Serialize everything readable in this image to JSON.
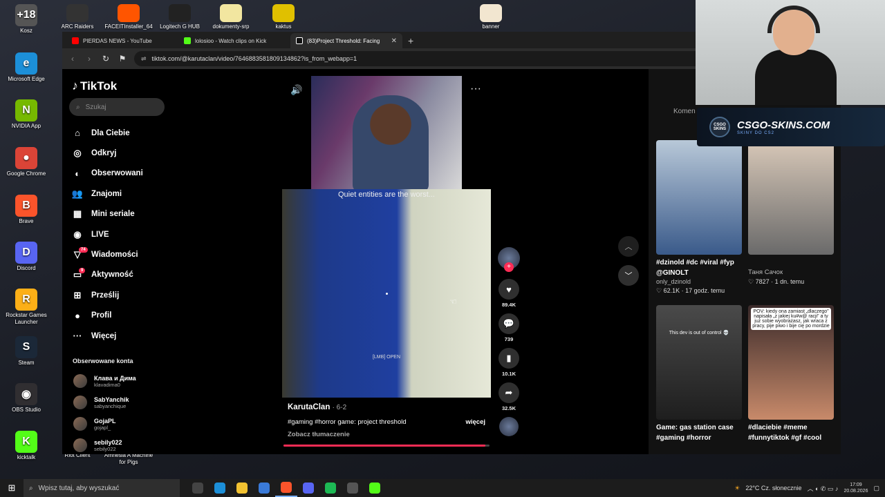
{
  "desktop_icons": [
    {
      "label": "Kosz",
      "glyph": "+18",
      "color": "#555"
    },
    {
      "label": "Microsoft Edge",
      "glyph": "e",
      "color": "#1c8fd8"
    },
    {
      "label": "NVIDIA App",
      "glyph": "N",
      "color": "#76b900"
    },
    {
      "label": "Google Chrome",
      "glyph": "●",
      "color": "#db4437"
    },
    {
      "label": "Brave",
      "glyph": "B",
      "color": "#fb542b"
    },
    {
      "label": "Discord",
      "glyph": "D",
      "color": "#5865f2"
    },
    {
      "label": "Rockstar Games Launcher",
      "glyph": "R",
      "color": "#fcaf17"
    },
    {
      "label": "Steam",
      "glyph": "S",
      "color": "#1b2838"
    },
    {
      "label": "OBS Studio",
      "glyph": "◉",
      "color": "#302e31"
    },
    {
      "label": "kicktalk",
      "glyph": "K",
      "color": "#53fc18"
    }
  ],
  "top_icons": [
    {
      "label": "ARC Raiders",
      "color": "#333"
    },
    {
      "label": "FACEITInstaller_64",
      "color": "#ff5500"
    },
    {
      "label": "Logitech G HUB",
      "color": "#222"
    },
    {
      "label": "dokumenty-srp",
      "color": "#f2e6a0"
    },
    {
      "label": "kaktus",
      "color": "#e0c000"
    },
    {
      "label": "banner",
      "color": "#f2e6d0"
    }
  ],
  "bottom_icons": [
    {
      "label": "Riot Client"
    },
    {
      "label": "Amnesia A Machine for Pigs"
    }
  ],
  "browser": {
    "tabs": [
      {
        "title": "PIERDAS NEWS - YouTube",
        "color": "#ff0000"
      },
      {
        "title": "lolosioo - Watch clips on Kick",
        "color": "#53fc18"
      },
      {
        "title": "(83)Project Threshold: Facing",
        "color": "#fff"
      }
    ],
    "new_tab": "+",
    "url": "tiktok.com/@karutaclan/video/7646883581809134862?is_from_webapp=1"
  },
  "tiktok": {
    "logo": "TikTok",
    "search_placeholder": "Szukaj",
    "nav": [
      {
        "label": "Dla Ciebie",
        "icon": "home-icon",
        "glyph": "⌂"
      },
      {
        "label": "Odkryj",
        "icon": "compass-icon",
        "glyph": "◎"
      },
      {
        "label": "Obserwowani",
        "icon": "following-icon",
        "glyph": "◐"
      },
      {
        "label": "Znajomi",
        "icon": "friends-icon",
        "glyph": "👥"
      },
      {
        "label": "Mini seriale",
        "icon": "film-icon",
        "glyph": "▦"
      },
      {
        "label": "LIVE",
        "icon": "live-icon",
        "glyph": "◉"
      },
      {
        "label": "Wiadomości",
        "icon": "messages-icon",
        "glyph": "▽",
        "badge": "74"
      },
      {
        "label": "Aktywność",
        "icon": "activity-icon",
        "glyph": "▭",
        "badge": "9"
      },
      {
        "label": "Prześlij",
        "icon": "upload-icon",
        "glyph": "⊞"
      },
      {
        "label": "Profil",
        "icon": "profile-icon",
        "glyph": "●"
      },
      {
        "label": "Więcej",
        "icon": "more-icon",
        "glyph": "···"
      }
    ],
    "following_title": "Obserwowane konta",
    "following": [
      {
        "name": "Клава и Дима",
        "handle": "klavadima0"
      },
      {
        "name": "SabYanchik",
        "handle": "sabyanchique"
      },
      {
        "name": "GojaPL",
        "handle": "gojapl_"
      },
      {
        "name": "sebily022",
        "handle": "sebily022"
      }
    ],
    "video": {
      "caption": "Quiet entities are the worst...",
      "open_label": "[LMB] OPEN",
      "author": "KarutaClan",
      "date": "· 6-2",
      "description": "#gaming #horror  game: project threshold",
      "more": "więcej",
      "translate": "Zobacz tłumaczenie",
      "progress": 0.98
    },
    "actions": {
      "likes": "89.4K",
      "comments": "739",
      "saves": "10.1K",
      "shares": "32.5K"
    },
    "comments_tab": "Komen",
    "recommended": [
      {
        "title": "#dzinold #dc #viral #fyp @GINOLT",
        "user": "only_dzinold",
        "meta": "♡ 62.1K · 17 godz. temu",
        "c1": "#b8c8d8",
        "c2": "#3a5a8a"
      },
      {
        "title": "",
        "user": "Таня Сачок",
        "meta": "♡ 7827 · 1 dn. temu",
        "c1": "#d8c8b8",
        "c2": "#6a6a6a"
      },
      {
        "title": "Game: gas station case #gaming #horror",
        "user": "",
        "meta": "",
        "c1": "#4a4a4a",
        "c2": "#1e1e1e",
        "overlay": "This dev is out of control 💀"
      },
      {
        "title": "#dlaciebie #meme #funnytiktok #gf #cool",
        "user": "",
        "meta": "",
        "c1": "#3a2a2a",
        "c2": "#c88a6a",
        "overlay": "POV: kiedy ona zamiast „dlaczego” napisała „z jakiej ku#w@ racji” a ty już sobie wyobrażasz, jak wraca z pracy, pije piwo i bije cię po mordzie"
      }
    ]
  },
  "sponsor": {
    "name": "CSGO-SKINS.COM",
    "sub": "SKINY DO CS2",
    "logo": "CSGO SKINS"
  },
  "taskbar": {
    "search_placeholder": "Wpisz tutaj, aby wyszukać",
    "weather": "22°C  Cz. słonecznie",
    "time": "17:09",
    "date": "20.08.2026",
    "apps": [
      {
        "name": "task-view",
        "color": "#444"
      },
      {
        "name": "edge",
        "color": "#1c8fd8"
      },
      {
        "name": "explorer",
        "color": "#f2c231"
      },
      {
        "name": "mail",
        "color": "#3a7ad8"
      },
      {
        "name": "brave",
        "color": "#fb542b"
      },
      {
        "name": "discord",
        "color": "#5865f2"
      },
      {
        "name": "spotify",
        "color": "#1db954"
      },
      {
        "name": "obs",
        "color": "#555"
      },
      {
        "name": "kick",
        "color": "#53fc18"
      }
    ]
  }
}
